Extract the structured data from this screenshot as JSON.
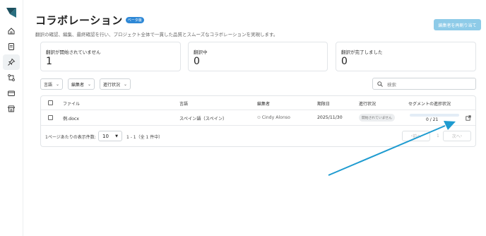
{
  "header": {
    "title": "コラボレーション",
    "beta_badge": "ベータ版",
    "subtitle": "翻訳の確認、編集、最終確認を行い、プロジェクト全体で一貫した品質とスムーズなコラボレーションを実現します。",
    "reassign_button": "編集者を再割り当て"
  },
  "sidebar": {
    "icons": [
      "home-icon",
      "document-icon",
      "pin-icon",
      "workflow-icon",
      "card-icon",
      "store-icon"
    ],
    "active_index": 2
  },
  "cards": [
    {
      "label": "翻訳が開始されていません",
      "value": "1"
    },
    {
      "label": "翻訳中",
      "value": "0"
    },
    {
      "label": "翻訳が完了しました",
      "value": "0"
    }
  ],
  "filters": {
    "language": "言語",
    "editor": "編集者",
    "status": "進行状況",
    "search_placeholder": "検索"
  },
  "table": {
    "headers": {
      "file": "ファイル",
      "language": "言語",
      "editor": "編集者",
      "due": "期限日",
      "status": "進行状況",
      "progress": "セグメントの進捗状況"
    },
    "rows": [
      {
        "file": "例.docx",
        "language": "スペイン語（スペイン）",
        "editor": "Cindy Alonso",
        "due": "2025/11/30",
        "status": "開始されていません",
        "progress_text": "0 / 21",
        "progress_fraction": 0.0
      }
    ]
  },
  "pagination": {
    "per_page_label": "1ページあたりの表示件数:",
    "per_page_value": "10",
    "range_text": "1 - 1（全 1 件中）",
    "prev": "前へ",
    "page": "1",
    "next": "次へ"
  },
  "colors": {
    "accent": "#2e88d6",
    "reassign_button": "#8ecbe8",
    "annotation_arrow": "#1e9bd0"
  }
}
